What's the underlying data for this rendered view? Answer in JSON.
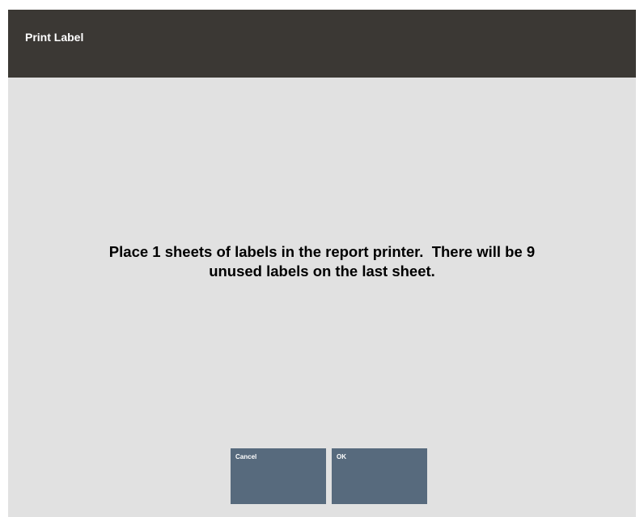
{
  "dialog": {
    "title": "Print Label",
    "message_line1": "Place 1 sheets of labels in the report printer.  There will be 9",
    "message_line2": "unused labels on the last sheet."
  },
  "buttons": {
    "cancel_label": "Cancel",
    "ok_label": "OK"
  },
  "colors": {
    "titlebar": "#3b3834",
    "background": "#e1e1e1",
    "button": "#576a7d",
    "title_text": "#ffffff",
    "message_text": "#000000"
  }
}
